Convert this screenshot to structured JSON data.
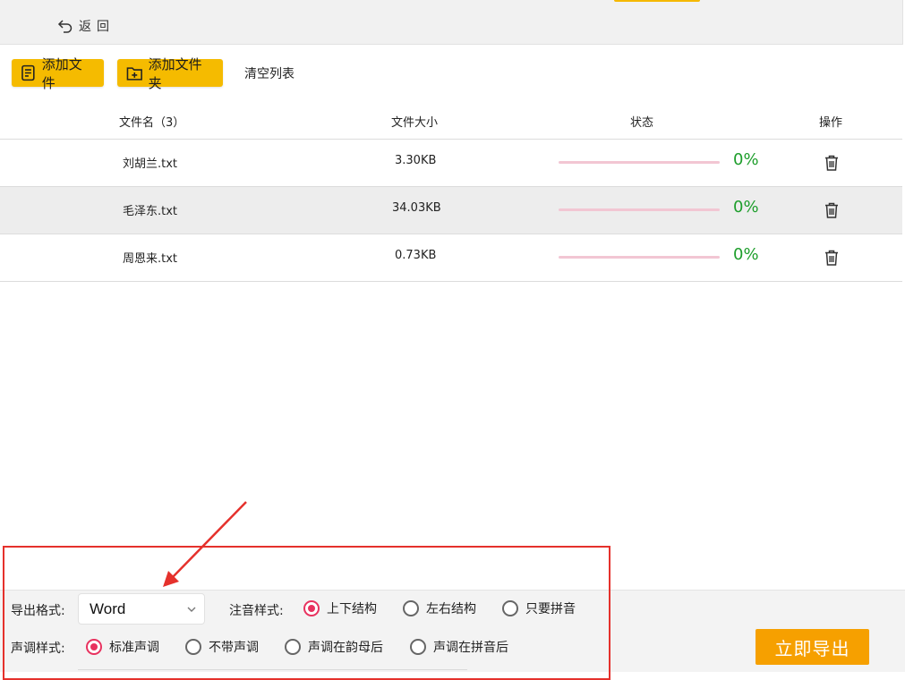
{
  "header": {
    "back_label": "返回"
  },
  "toolbar": {
    "add_file_label": "添加文件",
    "add_folder_label": "添加文件夹",
    "clear_label": "清空列表"
  },
  "table": {
    "columns": {
      "name": "文件名（3）",
      "size": "文件大小",
      "status": "状态",
      "action": "操作"
    },
    "rows": [
      {
        "name": "刘胡兰.txt",
        "size": "3.30KB",
        "progress": "0%"
      },
      {
        "name": "毛泽东.txt",
        "size": "34.03KB",
        "progress": "0%"
      },
      {
        "name": "周恩来.txt",
        "size": "0.73KB",
        "progress": "0%"
      }
    ]
  },
  "settings": {
    "export_format_label": "导出格式:",
    "export_format_value": "Word",
    "annotation_label": "注音样式:",
    "annotation_options": [
      "上下结构",
      "左右结构",
      "只要拼音"
    ],
    "annotation_selected": 0,
    "tone_label": "声调样式:",
    "tone_options": [
      "标准声调",
      "不带声调",
      "声调在韵母后",
      "声调在拼音后"
    ],
    "tone_selected": 0,
    "export_button": "立即导出"
  },
  "colors": {
    "accent_yellow": "#f5bb00",
    "export_orange": "#f6a000",
    "progress_pink": "#f2c6d3",
    "percent_green": "#1e9e2c",
    "radio_selected": "#e8325f",
    "annotation_red": "#e5312c"
  },
  "icons": {
    "back": "back-arrow-icon",
    "add_file": "file-list-icon",
    "add_folder": "folder-plus-icon",
    "delete": "trash-icon",
    "dropdown": "chevron-down-icon"
  }
}
